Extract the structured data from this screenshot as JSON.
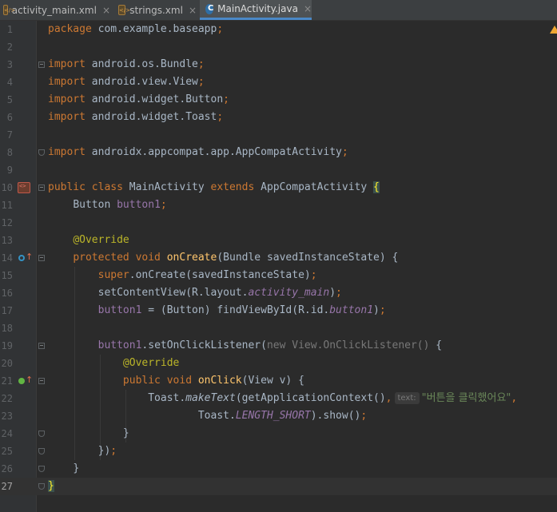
{
  "tabs": [
    {
      "label": "activity_main.xml",
      "icon": "xml-file-icon",
      "active": false
    },
    {
      "label": "strings.xml",
      "icon": "xml-file-icon",
      "active": false
    },
    {
      "label": "MainActivity.java",
      "icon": "java-class-icon",
      "active": true
    }
  ],
  "close_glyph": "×",
  "editor": {
    "current_line": 27,
    "inline_hint": "text:",
    "line_numbers": [
      "1",
      "2",
      "3",
      "4",
      "5",
      "6",
      "7",
      "8",
      "9",
      "10",
      "11",
      "12",
      "13",
      "14",
      "15",
      "16",
      "17",
      "18",
      "19",
      "20",
      "21",
      "22",
      "23",
      "24",
      "25",
      "26",
      "27"
    ],
    "code": {
      "l1": {
        "kw": "package",
        "rest": " com.example.baseapp",
        "semi": ";"
      },
      "l3": {
        "kw": "import",
        "rest": " android.os.Bundle",
        "semi": ";"
      },
      "l4": {
        "kw": "import",
        "rest": " android.view.View",
        "semi": ";"
      },
      "l5": {
        "kw": "import",
        "rest": " android.widget.Button",
        "semi": ";"
      },
      "l6": {
        "kw": "import",
        "rest": " android.widget.Toast",
        "semi": ";"
      },
      "l8": {
        "kw": "import",
        "rest": " androidx.appcompat.app.AppCompatActivity",
        "semi": ";"
      },
      "l10": {
        "kw1": "public class",
        "name": " MainActivity ",
        "kw2": "extends",
        "rest": " AppCompatActivity ",
        "brace": "{"
      },
      "l11": {
        "type": "Button ",
        "field": "button1",
        "semi": ";"
      },
      "l13": {
        "ann": "@Override"
      },
      "l14": {
        "kw": "protected void",
        "fn": " onCreate",
        "rest": "(Bundle savedInstanceState) {"
      },
      "l15": {
        "kw": "super",
        "rest": ".onCreate(savedInstanceState)",
        "semi": ";"
      },
      "l16": {
        "pre": "setContentView(R.layout.",
        "field": "activity_main",
        "post": ")",
        "semi": ";"
      },
      "l17": {
        "field1": "button1",
        "mid": " = (Button) findViewById(R.id.",
        "field2": "button1",
        "post": ")",
        "semi": ";"
      },
      "l19": {
        "field": "button1",
        "mid": ".setOnClickListener(",
        "gray": "new View.OnClickListener()",
        "post": " {"
      },
      "l20": {
        "ann": "@Override"
      },
      "l21": {
        "kw": "public void",
        "fn": " onClick",
        "rest": "(View v) {"
      },
      "l22": {
        "pre": "Toast.",
        "method": "makeText",
        "mid": "(getApplicationContext()",
        "comma": ",",
        "str": "\"버튼을 클릭했어요\"",
        "comma2": ","
      },
      "l23": {
        "pre": "Toast.",
        "field": "LENGTH_SHORT",
        "post": ").show()",
        "semi": ";"
      },
      "l24": {
        "text": "}"
      },
      "l25": {
        "text": "})",
        "semi": ";"
      },
      "l26": {
        "text": "}"
      },
      "l27": {
        "text": "}"
      }
    }
  },
  "colors": {
    "background": "#2b2b2b",
    "gutter": "#313335",
    "keyword": "#cc7832",
    "annotation": "#bbb529",
    "method_decl": "#ffc66d",
    "field": "#9876aa",
    "string": "#6a8759",
    "plain": "#a9b7c6",
    "line_number": "#606366"
  }
}
